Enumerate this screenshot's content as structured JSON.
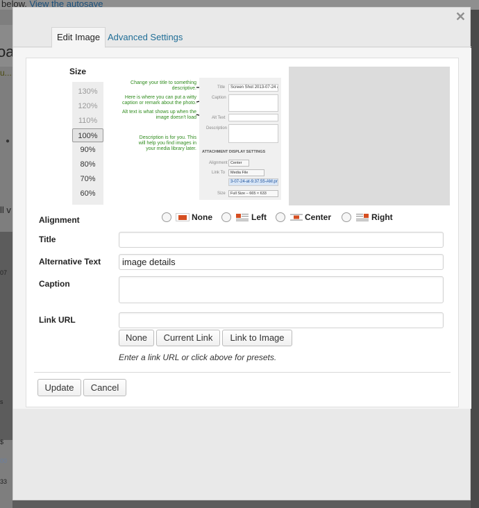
{
  "background": {
    "top_text": "below.",
    "top_link": "View the autosave",
    "left_fragments": [
      "oa",
      "u...",
      "ll v",
      "07",
      "s",
      "$",
      "00",
      "33"
    ]
  },
  "modal": {
    "close_icon": "close-icon",
    "tabs": [
      {
        "label": "Edit Image",
        "active": true
      },
      {
        "label": "Advanced Settings",
        "active": false
      }
    ]
  },
  "size": {
    "label": "Size",
    "options": [
      "130%",
      "120%",
      "110%",
      "100%",
      "90%",
      "80%",
      "70%",
      "60%"
    ],
    "selected": "100%"
  },
  "annotation": {
    "notes": [
      "Change your title to something descriptive.",
      "Here is where you can put a witty caption or remark about the photo.",
      "Alt text is what shows up when the image doesn't load",
      "Description is for you. This will help you find images in your media library later."
    ],
    "form": {
      "title_label": "Title",
      "title_value": "Screen Shot 2013-07-24 at",
      "caption_label": "Caption",
      "alt_label": "Alt Text",
      "description_label": "Description",
      "section_title": "ATTACHMENT DISPLAY SETTINGS",
      "alignment_label": "Alignment",
      "alignment_value": "Center",
      "link_label": "Link To",
      "link_value": "Media File",
      "url_value": "3-07-24-at-9.37.55-AM.png",
      "size_label": "Size",
      "size_value": "Full Size – 665 × 633"
    }
  },
  "alignment": {
    "label": "Alignment",
    "options": [
      "None",
      "Left",
      "Center",
      "Right"
    ],
    "accent": "#d54e21"
  },
  "fields": {
    "title_label": "Title",
    "title_value": "",
    "alt_label": "Alternative Text",
    "alt_value": "image details",
    "caption_label": "Caption",
    "caption_value": "",
    "link_label": "Link URL",
    "link_value": ""
  },
  "link_buttons": [
    "None",
    "Current Link",
    "Link to Image"
  ],
  "hint": "Enter a link URL or click above for presets.",
  "actions": {
    "update": "Update",
    "cancel": "Cancel"
  }
}
